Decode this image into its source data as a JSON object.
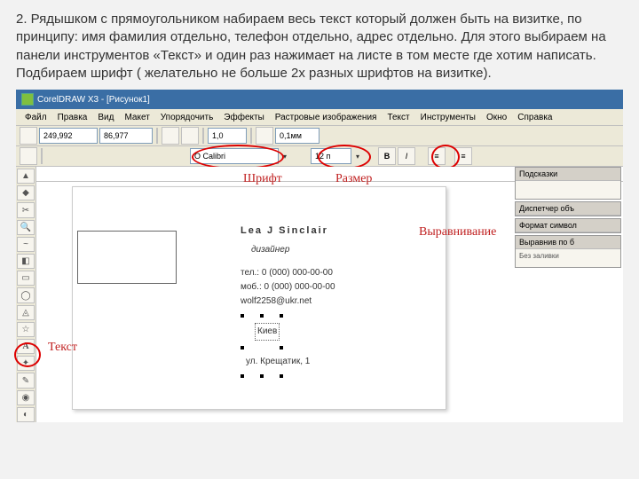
{
  "instruction_text": "2. Рядышком с прямоугольником набираем весь текст который должен быть на визитке, по принципу: имя фамилия отдельно, телефон отдельно, адрес отдельно. Для этого выбираем на панели инструментов «Текст» и один раз нажимает на листе в том месте где хотим написать. Подбираем шрифт ( желательно не больше 2х разных шрифтов на визитке).",
  "window": {
    "title": "CorelDRAW X3 - [Рисунок1]"
  },
  "menubar": {
    "items": [
      "Файл",
      "Правка",
      "Вид",
      "Макет",
      "Упорядочить",
      "Эффекты",
      "Растровые изображения",
      "Текст",
      "Инструменты",
      "Окно",
      "Справка"
    ]
  },
  "toolbar1": {
    "paper_size": "249,992",
    "paper_w": "86,977",
    "units": "1,0",
    "snap": "0,1мм"
  },
  "toolbar2": {
    "font_name": "O Calibri",
    "font_size": "12 п",
    "bold": "B",
    "italic": "I",
    "align": "≡",
    "bullets": "≡"
  },
  "dockers": {
    "d1": "Подсказки",
    "d2": "Диспетчер объ",
    "d3": "Формат символ",
    "d4": "Выравнив по б",
    "d5": "Без заливки"
  },
  "card": {
    "name": "Lea J Sinclair",
    "role": "дизайнер",
    "tel": "тел.: 0 (000) 000-00-00",
    "mob": "моб.: 0 (000) 000-00-00",
    "email": "wolf2258@ukr.net",
    "city": "Киев",
    "street": "ул. Крещатик, 1"
  },
  "annotations": {
    "font": "Шрифт",
    "size": "Размер",
    "align": "Выравнивание",
    "text": "Текст"
  },
  "tooltips": {
    "pick": "▲",
    "shape": "◆",
    "crop": "✂",
    "zoom": "🔍",
    "curve": "~",
    "rect": "▭",
    "ellipse": "◯",
    "poly": "◬",
    "basic": "☆",
    "text": "A",
    "interactive": "✦",
    "eyedrop": "✎",
    "outline": "◉",
    "fill": "◐",
    "smart": "◧"
  }
}
